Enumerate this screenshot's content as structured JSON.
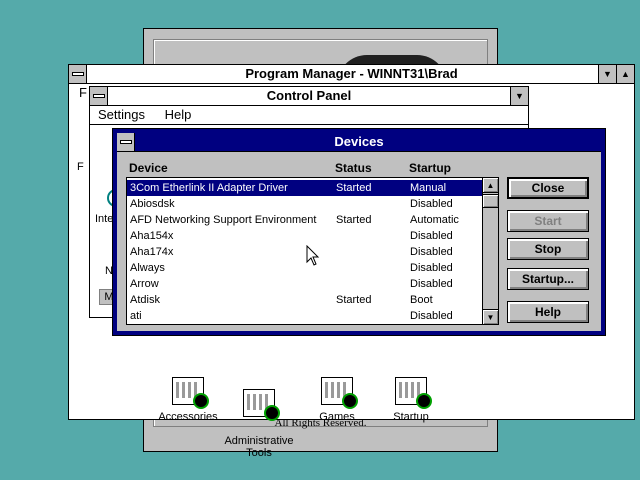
{
  "splash": {
    "copyright": "All Rights Reserved."
  },
  "program_manager": {
    "title": "Program Manager - WINNT31\\Brad",
    "menu_first_letter": "F",
    "groups": [
      {
        "label": "Accessories"
      },
      {
        "label": "Administrative\nTools"
      },
      {
        "label": "Games"
      },
      {
        "label": "Startup"
      }
    ]
  },
  "control_panel": {
    "title": "Control Panel",
    "menus": [
      "Settings",
      "Help"
    ],
    "partial_labels": {
      "inte": "Inte",
      "n": "N",
      "m": "M",
      "f": "F"
    }
  },
  "devices": {
    "title": "Devices",
    "headers": {
      "device": "Device",
      "status": "Status",
      "startup": "Startup"
    },
    "rows": [
      {
        "device": "3Com Etherlink II Adapter Driver",
        "status": "Started",
        "startup": "Manual",
        "selected": true
      },
      {
        "device": "Abiosdsk",
        "status": "",
        "startup": "Disabled"
      },
      {
        "device": "AFD Networking Support Environment",
        "status": "Started",
        "startup": "Automatic"
      },
      {
        "device": "Aha154x",
        "status": "",
        "startup": "Disabled"
      },
      {
        "device": "Aha174x",
        "status": "",
        "startup": "Disabled"
      },
      {
        "device": "Always",
        "status": "",
        "startup": "Disabled"
      },
      {
        "device": "Arrow",
        "status": "",
        "startup": "Disabled"
      },
      {
        "device": "Atdisk",
        "status": "Started",
        "startup": "Boot"
      },
      {
        "device": "ati",
        "status": "",
        "startup": "Disabled"
      }
    ],
    "buttons": {
      "close": "Close",
      "start": "Start",
      "stop": "Stop",
      "startup": "Startup...",
      "help": "Help"
    }
  },
  "colors": {
    "desktop": "#55aaaa",
    "active_title": "#000080",
    "window_gray": "#c0c0c0"
  },
  "icons": [
    "system-menu-icon",
    "minimize-icon",
    "maximize-icon",
    "scroll-up-icon",
    "scroll-down-icon",
    "program-group-icon",
    "mouse-pointer-icon"
  ]
}
